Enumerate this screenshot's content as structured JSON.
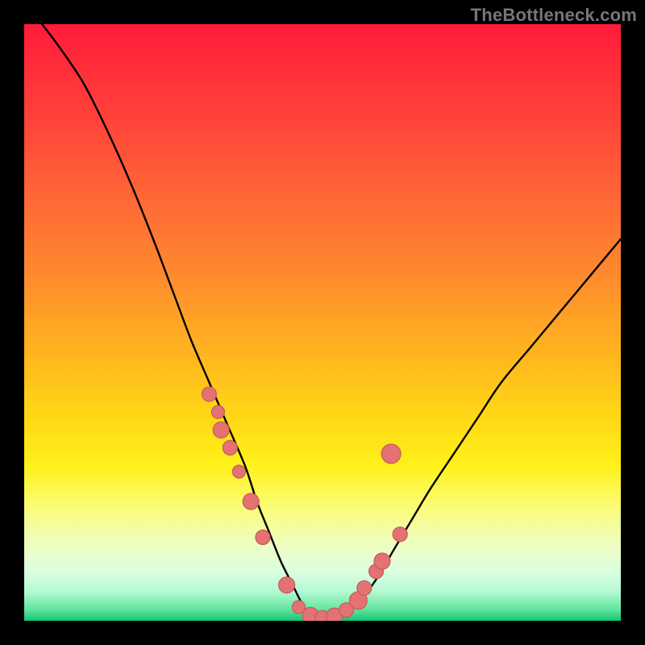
{
  "watermark": "TheBottleneck.com",
  "colors": {
    "background": "#000000",
    "curve": "#000000",
    "marker_fill": "#e47272",
    "marker_stroke": "#c85a5a"
  },
  "chart_data": {
    "type": "line",
    "title": "",
    "xlabel": "",
    "ylabel": "",
    "xlim": [
      0,
      100
    ],
    "ylim": [
      0,
      100
    ],
    "series": [
      {
        "name": "bottleneck-curve",
        "x": [
          3,
          6,
          10,
          14,
          18,
          22,
          25,
          28,
          31,
          34,
          37,
          39,
          41,
          43,
          45,
          46.5,
          47.5,
          48.5,
          50,
          52,
          54,
          56,
          58,
          60,
          62,
          65,
          68,
          72,
          76,
          80,
          85,
          90,
          95,
          100
        ],
        "y": [
          100,
          96,
          90,
          82,
          73,
          63,
          55,
          47,
          40,
          33,
          26,
          20,
          15,
          10,
          6,
          3,
          1.5,
          0.8,
          0.5,
          0.7,
          1.5,
          3,
          5.5,
          8.5,
          12,
          17,
          22,
          28,
          34,
          40,
          46,
          52,
          58,
          64
        ]
      }
    ],
    "markers": {
      "name": "highlight-points",
      "x": [
        31,
        32.5,
        33,
        34.5,
        36,
        38,
        40,
        44,
        46,
        48,
        50,
        52,
        54,
        56,
        57,
        59,
        60,
        61.5,
        63
      ],
      "y": [
        38,
        35,
        32,
        29,
        25,
        20,
        14,
        6,
        2.3,
        0.9,
        0.5,
        0.8,
        1.8,
        3.4,
        5.5,
        8.3,
        10,
        28,
        14.5
      ],
      "r": [
        9,
        8,
        10,
        9,
        8,
        10,
        9,
        10,
        8,
        10,
        9,
        10,
        9,
        11,
        9,
        9,
        10,
        12,
        9
      ]
    },
    "gradient_stops": [
      {
        "pos": 0,
        "color": "#ff1a3a"
      },
      {
        "pos": 6,
        "color": "#ff2a3a"
      },
      {
        "pos": 18,
        "color": "#ff4839"
      },
      {
        "pos": 30,
        "color": "#ff6a36"
      },
      {
        "pos": 42,
        "color": "#ff8a2e"
      },
      {
        "pos": 55,
        "color": "#ffb41f"
      },
      {
        "pos": 66,
        "color": "#ffd815"
      },
      {
        "pos": 74,
        "color": "#fff11a"
      },
      {
        "pos": 80,
        "color": "#fcfb6a"
      },
      {
        "pos": 85,
        "color": "#f3fdaa"
      },
      {
        "pos": 89,
        "color": "#e9fed0"
      },
      {
        "pos": 92,
        "color": "#d8fee0"
      },
      {
        "pos": 95,
        "color": "#b7f9d5"
      },
      {
        "pos": 98,
        "color": "#64e6a0"
      },
      {
        "pos": 100,
        "color": "#10c671"
      }
    ]
  }
}
